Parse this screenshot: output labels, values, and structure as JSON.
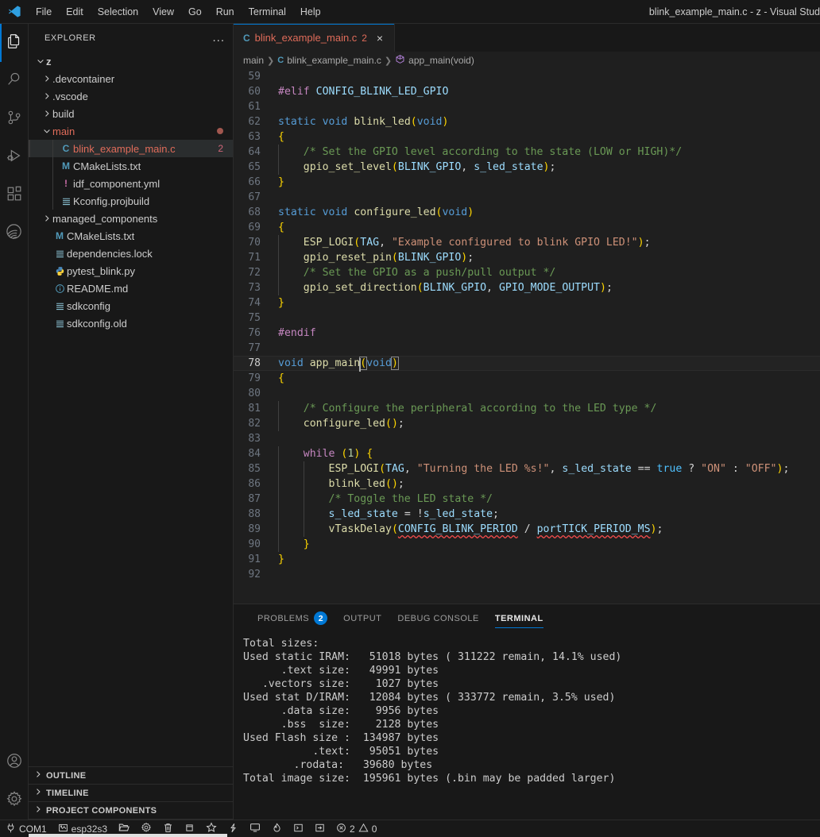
{
  "titlebar": {
    "menus": [
      "File",
      "Edit",
      "Selection",
      "View",
      "Go",
      "Run",
      "Terminal",
      "Help"
    ],
    "window_title": "blink_example_main.c - z - Visual Stud"
  },
  "activitybar": {
    "items": [
      {
        "name": "explorer",
        "icon": "files-icon",
        "active": true
      },
      {
        "name": "search",
        "icon": "search-icon",
        "active": false
      },
      {
        "name": "source-control",
        "icon": "source-control-icon",
        "active": false
      },
      {
        "name": "run-and-debug",
        "icon": "run-debug-icon",
        "active": false
      },
      {
        "name": "extensions",
        "icon": "extensions-icon",
        "active": false
      },
      {
        "name": "espressif-idf",
        "icon": "espressif-icon",
        "active": false
      }
    ],
    "bottom": [
      {
        "name": "accounts",
        "icon": "account-icon"
      },
      {
        "name": "manage",
        "icon": "gear-icon"
      }
    ]
  },
  "sidebar": {
    "title": "EXPLORER",
    "more_actions": "...",
    "tree": [
      {
        "label": "z",
        "indent": 0,
        "twisty": "down",
        "icon": "",
        "bold": true,
        "kind": "folder"
      },
      {
        "label": ".devcontainer",
        "indent": 1,
        "twisty": "right",
        "icon": "",
        "kind": "folder"
      },
      {
        "label": ".vscode",
        "indent": 1,
        "twisty": "right",
        "icon": "",
        "kind": "folder"
      },
      {
        "label": "build",
        "indent": 1,
        "twisty": "right",
        "icon": "",
        "kind": "folder"
      },
      {
        "label": "main",
        "indent": 1,
        "twisty": "down",
        "icon": "",
        "kind": "folder",
        "error": true,
        "dot": true
      },
      {
        "label": "blink_example_main.c",
        "indent": 2,
        "twisty": "none",
        "icon": "C",
        "icon_color": "#519aba",
        "kind": "file",
        "selected": true,
        "error": true,
        "badge": "2"
      },
      {
        "label": "CMakeLists.txt",
        "indent": 2,
        "twisty": "none",
        "icon": "M",
        "icon_color": "#519aba",
        "kind": "file"
      },
      {
        "label": "idf_component.yml",
        "indent": 2,
        "twisty": "none",
        "icon": "!",
        "icon_color": "#cb6ea8",
        "kind": "file"
      },
      {
        "label": "Kconfig.projbuild",
        "indent": 2,
        "twisty": "none",
        "icon": "lines",
        "icon_color": "#8cc4d6",
        "kind": "file"
      },
      {
        "label": "managed_components",
        "indent": 1,
        "twisty": "right",
        "icon": "",
        "kind": "folder"
      },
      {
        "label": "CMakeLists.txt",
        "indent": 1,
        "twisty": "none",
        "icon": "M",
        "icon_color": "#519aba",
        "kind": "file"
      },
      {
        "label": "dependencies.lock",
        "indent": 1,
        "twisty": "none",
        "icon": "lines",
        "icon_color": "#8cc4d6",
        "kind": "file"
      },
      {
        "label": "pytest_blink.py",
        "indent": 1,
        "twisty": "none",
        "icon": "py",
        "icon_color": "#519aba",
        "kind": "file"
      },
      {
        "label": "README.md",
        "indent": 1,
        "twisty": "none",
        "icon": "i",
        "icon_color": "#519aba",
        "kind": "file"
      },
      {
        "label": "sdkconfig",
        "indent": 1,
        "twisty": "none",
        "icon": "lines",
        "icon_color": "#8cc4d6",
        "kind": "file"
      },
      {
        "label": "sdkconfig.old",
        "indent": 1,
        "twisty": "none",
        "icon": "lines",
        "icon_color": "#8cc4d6",
        "kind": "file"
      }
    ],
    "sections": [
      "OUTLINE",
      "TIMELINE",
      "PROJECT COMPONENTS"
    ]
  },
  "editor": {
    "tab": {
      "icon": "C",
      "label": "blink_example_main.c",
      "error_count": "2",
      "close": "×"
    },
    "breadcrumb": [
      {
        "label": "main",
        "icon": ""
      },
      {
        "label": "blink_example_main.c",
        "icon": "C"
      },
      {
        "label": "app_main(void)",
        "icon": "symbol-method"
      }
    ],
    "first_line": 59,
    "active_line": 78,
    "lines": [
      {
        "n": 59,
        "text": ""
      },
      {
        "n": 60,
        "text": "#elif CONFIG_BLINK_LED_GPIO"
      },
      {
        "n": 61,
        "text": ""
      },
      {
        "n": 62,
        "text": "static void blink_led(void)"
      },
      {
        "n": 63,
        "text": "{"
      },
      {
        "n": 64,
        "text": "    /* Set the GPIO level according to the state (LOW or HIGH)*/"
      },
      {
        "n": 65,
        "text": "    gpio_set_level(BLINK_GPIO, s_led_state);"
      },
      {
        "n": 66,
        "text": "}"
      },
      {
        "n": 67,
        "text": ""
      },
      {
        "n": 68,
        "text": "static void configure_led(void)"
      },
      {
        "n": 69,
        "text": "{"
      },
      {
        "n": 70,
        "text": "    ESP_LOGI(TAG, \"Example configured to blink GPIO LED!\");"
      },
      {
        "n": 71,
        "text": "    gpio_reset_pin(BLINK_GPIO);"
      },
      {
        "n": 72,
        "text": "    /* Set the GPIO as a push/pull output */"
      },
      {
        "n": 73,
        "text": "    gpio_set_direction(BLINK_GPIO, GPIO_MODE_OUTPUT);"
      },
      {
        "n": 74,
        "text": "}"
      },
      {
        "n": 75,
        "text": ""
      },
      {
        "n": 76,
        "text": "#endif"
      },
      {
        "n": 77,
        "text": ""
      },
      {
        "n": 78,
        "text": "void app_main(void)"
      },
      {
        "n": 79,
        "text": "{"
      },
      {
        "n": 80,
        "text": ""
      },
      {
        "n": 81,
        "text": "    /* Configure the peripheral according to the LED type */"
      },
      {
        "n": 82,
        "text": "    configure_led();"
      },
      {
        "n": 83,
        "text": ""
      },
      {
        "n": 84,
        "text": "    while (1) {"
      },
      {
        "n": 85,
        "text": "        ESP_LOGI(TAG, \"Turning the LED %s!\", s_led_state == true ? \"ON\" : \"OFF\");"
      },
      {
        "n": 86,
        "text": "        blink_led();"
      },
      {
        "n": 87,
        "text": "        /* Toggle the LED state */"
      },
      {
        "n": 88,
        "text": "        s_led_state = !s_led_state;"
      },
      {
        "n": 89,
        "text": "        vTaskDelay(CONFIG_BLINK_PERIOD / portTICK_PERIOD_MS);"
      },
      {
        "n": 90,
        "text": "    }"
      },
      {
        "n": 91,
        "text": "}"
      },
      {
        "n": 92,
        "text": ""
      }
    ]
  },
  "panel": {
    "tabs": [
      {
        "label": "PROBLEMS",
        "badge": "2",
        "active": false
      },
      {
        "label": "OUTPUT",
        "badge": "",
        "active": false
      },
      {
        "label": "DEBUG CONSOLE",
        "badge": "",
        "active": false
      },
      {
        "label": "TERMINAL",
        "badge": "",
        "active": true
      }
    ],
    "terminal_output": "Total sizes:\nUsed static IRAM:   51018 bytes ( 311222 remain, 14.1% used)\n      .text size:   49991 bytes\n   .vectors size:    1027 bytes\nUsed stat D/IRAM:   12084 bytes ( 333772 remain, 3.5% used)\n      .data size:    9956 bytes\n      .bss  size:    2128 bytes\nUsed Flash size :  134987 bytes\n           .text:   95051 bytes\n        .rodata:   39680 bytes\nTotal image size:  195961 bytes (.bin may be padded larger)"
  },
  "statusbar": {
    "items": [
      {
        "name": "serial-port",
        "icon": "plug-icon",
        "label": "COM1"
      },
      {
        "name": "device-target",
        "icon": "chip-icon",
        "label": "esp32s3"
      },
      {
        "name": "open-folder",
        "icon": "folder-opened-icon",
        "label": ""
      },
      {
        "name": "sdk-configuration-editor",
        "icon": "gear-icon",
        "label": ""
      },
      {
        "name": "full-clean",
        "icon": "trash-icon",
        "label": ""
      },
      {
        "name": "build-project",
        "icon": "database-icon",
        "label": ""
      },
      {
        "name": "flash-device",
        "icon": "star-icon",
        "label": ""
      },
      {
        "name": "flash-method",
        "icon": "zap-icon",
        "label": ""
      },
      {
        "name": "monitor-device",
        "icon": "monitor-icon",
        "label": ""
      },
      {
        "name": "build-flash-monitor",
        "icon": "flame-icon",
        "label": ""
      },
      {
        "name": "open-terminal",
        "icon": "terminal-box-icon",
        "label": ""
      },
      {
        "name": "idf-custom-task",
        "icon": "arrow-box-icon",
        "label": ""
      }
    ],
    "problems": {
      "errors": "2",
      "warnings": "0"
    }
  }
}
